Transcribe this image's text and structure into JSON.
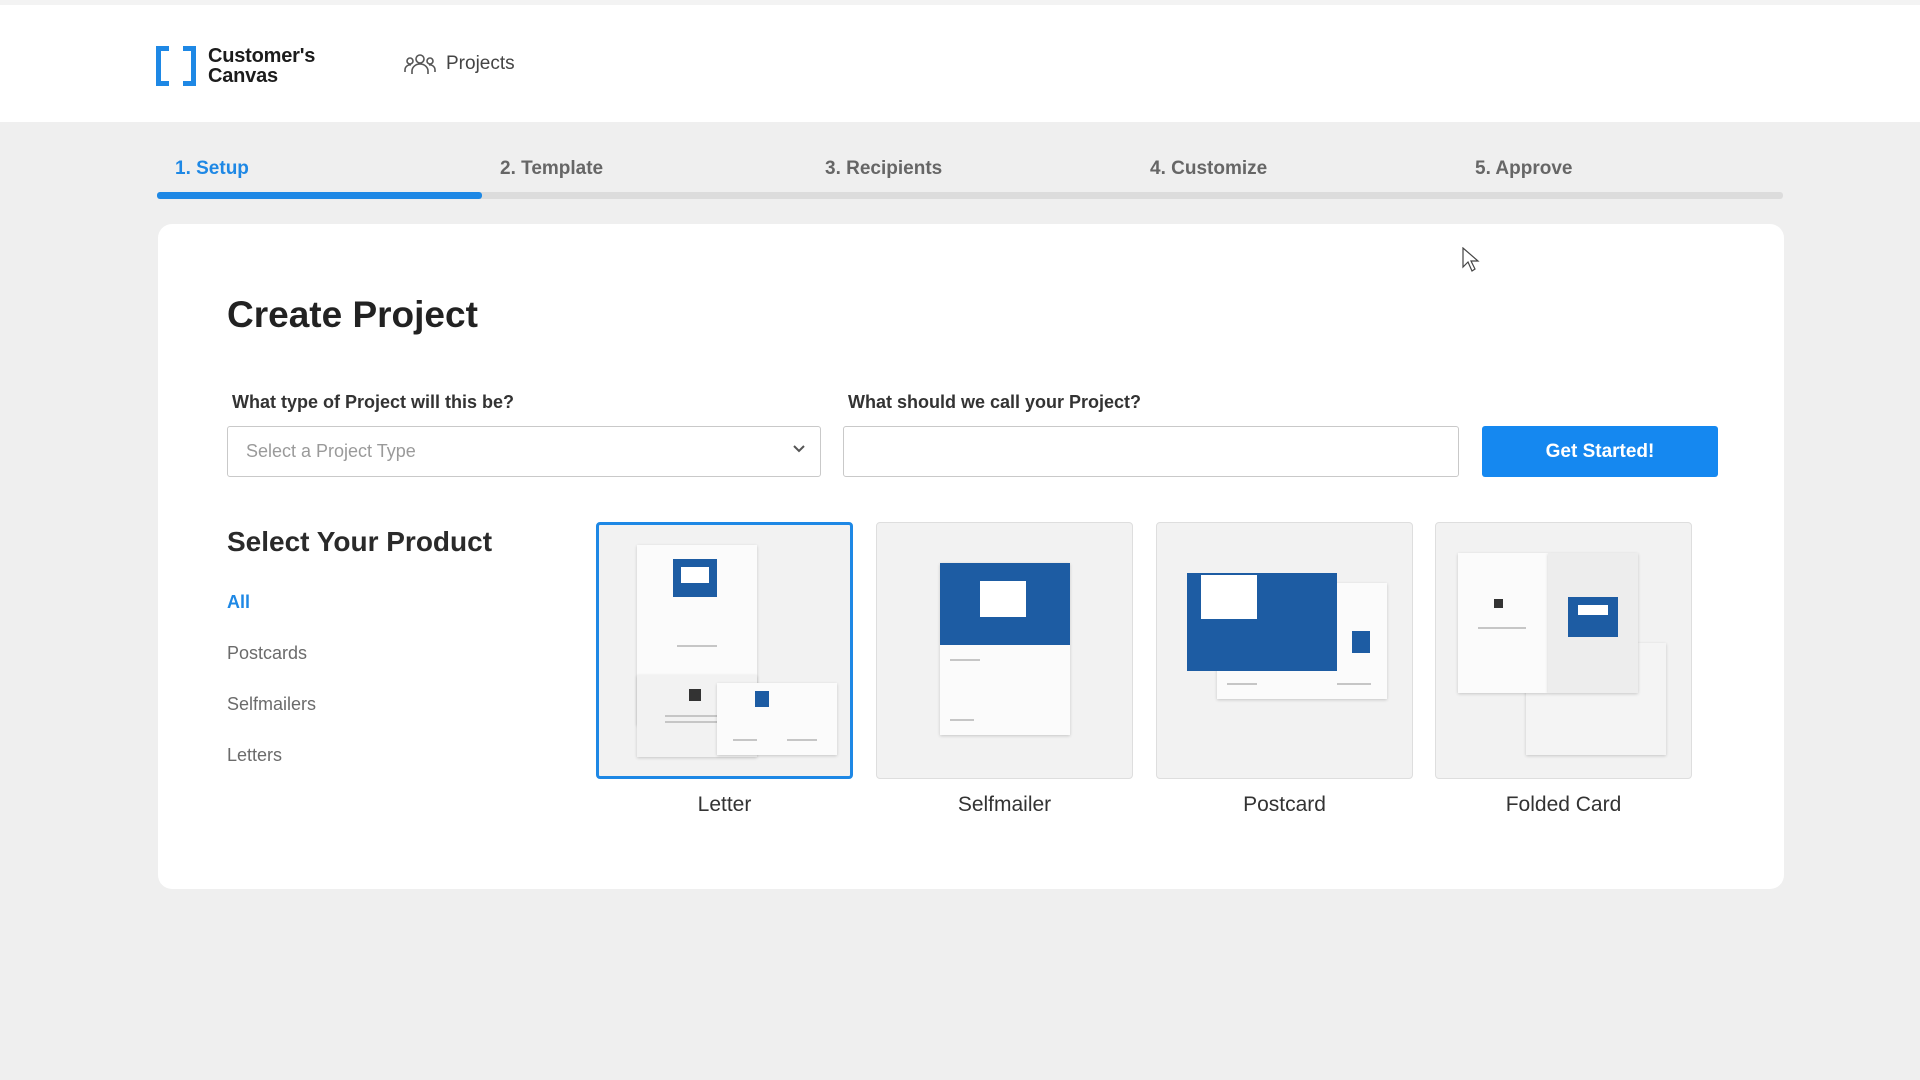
{
  "app": {
    "logo_line1": "Customer's",
    "logo_line2": "Canvas",
    "nav_projects": "Projects"
  },
  "steps": [
    {
      "label": "1. Setup",
      "active": true
    },
    {
      "label": "2. Template",
      "active": false
    },
    {
      "label": "3. Recipients",
      "active": false
    },
    {
      "label": "4. Customize",
      "active": false
    },
    {
      "label": "5. Approve",
      "active": false
    }
  ],
  "progress": {
    "completed_steps": 1,
    "total_steps": 5
  },
  "main": {
    "title": "Create Project",
    "type_label": "What type of Project will this be?",
    "type_placeholder": "Select a Project Type",
    "name_label": "What should we call your Project?",
    "name_value": "",
    "submit_label": "Get Started!",
    "products_title": "Select Your Product",
    "filters": [
      {
        "label": "All",
        "active": true
      },
      {
        "label": "Postcards",
        "active": false
      },
      {
        "label": "Selfmailers",
        "active": false
      },
      {
        "label": "Letters",
        "active": false
      }
    ],
    "products": [
      {
        "label": "Letter",
        "selected": true
      },
      {
        "label": "Selfmailer",
        "selected": false
      },
      {
        "label": "Postcard",
        "selected": false
      },
      {
        "label": "Folded Card",
        "selected": false
      }
    ]
  },
  "colors": {
    "accent": "#1e88e5",
    "button": "#1588f0",
    "brand_blue": "#1d5ca3",
    "background": "#efefef"
  },
  "icons": {
    "projects": "people-group-icon",
    "select": "chevron-down-icon",
    "logo": "bracket-logo-icon",
    "pointer": "mouse-cursor-icon"
  }
}
